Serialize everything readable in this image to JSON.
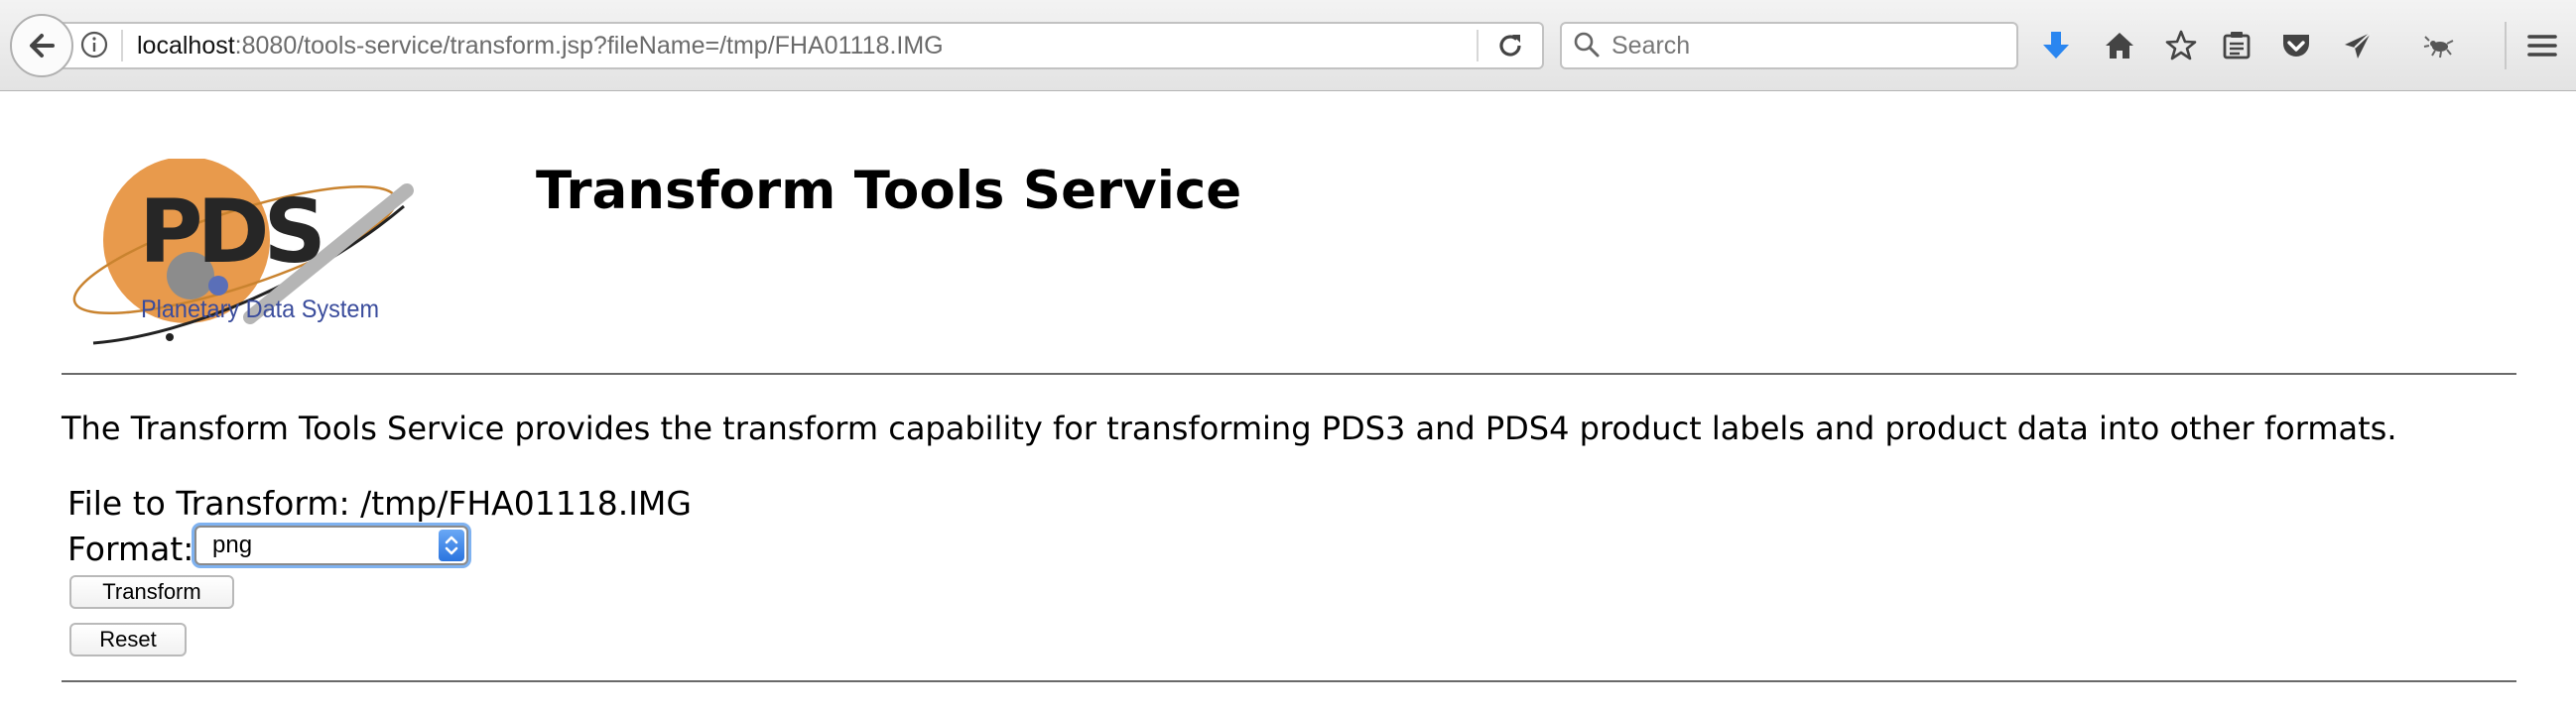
{
  "browser": {
    "url_host": "localhost",
    "url_rest": ":8080/tools-service/transform.jsp?fileName=/tmp/FHA01118.IMG",
    "search_placeholder": "Search",
    "icons": [
      "back-icon",
      "info-icon",
      "reload-icon",
      "search-icon",
      "download-icon",
      "home-icon",
      "bookmark-star-icon",
      "reading-list-icon",
      "pocket-icon",
      "send-icon",
      "extension-bug-icon",
      "menu-icon"
    ],
    "download_color": "#2a86f0"
  },
  "logo": {
    "letters": "PDS",
    "caption": "Planetary Data System",
    "planet_color": "#e89a4c"
  },
  "page": {
    "title": "Transform Tools Service",
    "description": "The Transform Tools Service provides the transform capability for transforming PDS3 and PDS4 product labels and product data into other formats.",
    "file_label": "File to Transform:",
    "file_name": "/tmp/FHA01118.IMG",
    "format_label": "Format:",
    "format_value": "png",
    "transform_button": "Transform",
    "reset_button": "Reset"
  }
}
